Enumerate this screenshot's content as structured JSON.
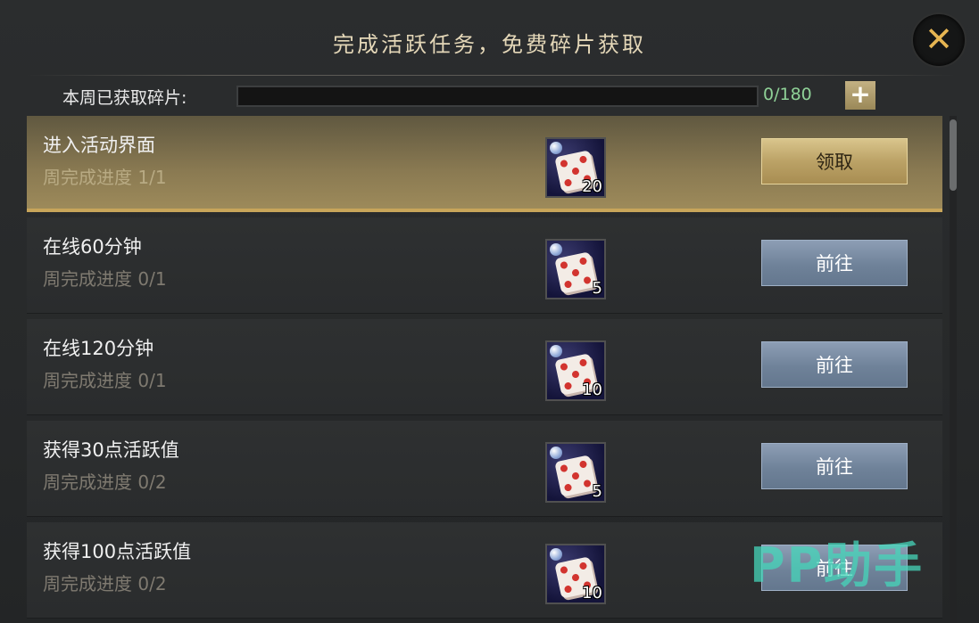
{
  "dialog": {
    "title": "完成活跃任务，免费碎片获取",
    "close_label": "✕"
  },
  "fragments": {
    "label": "本周已获取碎片:",
    "count": "0/180",
    "progress": 0.0,
    "plus_label": "+"
  },
  "tasks": [
    {
      "name": "进入活动界面",
      "progress": "周完成进度  1/1",
      "reward_qty": "20",
      "button": "领取",
      "state": "claim"
    },
    {
      "name": "在线60分钟",
      "progress": "周完成进度  0/1",
      "reward_qty": "5",
      "button": "前往",
      "state": "goto"
    },
    {
      "name": "在线120分钟",
      "progress": "周完成进度  0/1",
      "reward_qty": "10",
      "button": "前往",
      "state": "goto"
    },
    {
      "name": "获得30点活跃值",
      "progress": "周完成进度  0/2",
      "reward_qty": "5",
      "button": "前往",
      "state": "goto"
    },
    {
      "name": "获得100点活跃值",
      "progress": "周完成进度  0/2",
      "reward_qty": "10",
      "button": "前往",
      "state": "goto"
    }
  ],
  "watermark": "PP助手",
  "colors": {
    "accent_gold": "#c8a55a",
    "claim_button": "#bba266",
    "goto_button": "#6f8299",
    "fragment_count": "#8fd197",
    "watermark": "#46d6ba"
  }
}
